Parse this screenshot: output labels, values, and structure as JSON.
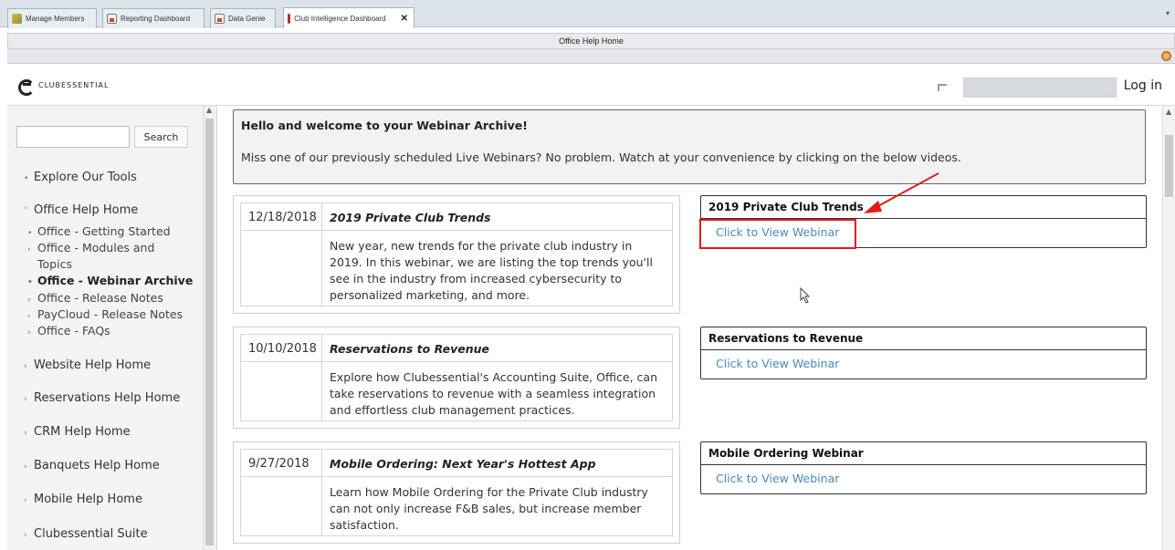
{
  "tabs": [
    {
      "label": "Manage Members",
      "icon": "members-icon"
    },
    {
      "label": "Reporting Dashboard",
      "icon": "report-icon"
    },
    {
      "label": "Data Genie",
      "icon": "report-icon"
    },
    {
      "label": "Club Intelligence Dashboard",
      "icon": "club-icon",
      "active": true
    }
  ],
  "window_title": "Office Help Home",
  "header": {
    "logo_text": "CLUBESSENTIAL",
    "search_placeholder": "",
    "login_label": "Log in"
  },
  "sidebar": {
    "search_button": "Search",
    "search_value": "",
    "items": [
      {
        "label": "Explore Our Tools"
      },
      {
        "label": "Office Help Home",
        "expanded": true
      },
      {
        "label": "Website Help Home"
      },
      {
        "label": "Reservations Help Home"
      },
      {
        "label": "CRM Help Home"
      },
      {
        "label": "Banquets Help Home"
      },
      {
        "label": "Mobile Help Home"
      },
      {
        "label": "Clubessential Suite"
      }
    ],
    "subitems": [
      {
        "label": "Office - Getting Started"
      },
      {
        "label": "Office - Modules and"
      },
      {
        "label": "Topics"
      },
      {
        "label": "Office - Webinar Archive",
        "active": true
      },
      {
        "label": "Office - Release Notes"
      },
      {
        "label": "PayCloud - Release Notes"
      },
      {
        "label": "Office - FAQs"
      }
    ]
  },
  "welcome": {
    "heading": "Hello and welcome to your Webinar Archive!",
    "text": "Miss one of our previously scheduled Live Webinars? No problem. Watch at your convenience by clicking on the below videos."
  },
  "webinars": [
    {
      "date": "12/18/2018",
      "title": "2019 Private Club Trends",
      "description": "New year, new trends for the private club industry in 2019. In this webinar, we are listing the top trends you'll see in the industry from increased cybersecurity to personalized marketing, and more.",
      "box_title": "2019 Private Club Trends",
      "link": "Click to View Webinar"
    },
    {
      "date": "10/10/2018",
      "title": "Reservations to Revenue",
      "description": "Explore how Clubessential's Accounting Suite, Office, can take reservations to revenue with a seamless integration and effortless club management practices.",
      "box_title": "Reservations to Revenue",
      "link": "Click to View Webinar"
    },
    {
      "date": "9/27/2018",
      "title": "Mobile Ordering: Next Year's Hottest App",
      "description": "Learn how Mobile Ordering for the Private Club industry can not only increase F&B sales, but increase member satisfaction.",
      "box_title": "Mobile Ordering Webinar",
      "link": "Click to View Webinar"
    }
  ],
  "colors": {
    "link": "#4a89b8",
    "annotation": "#e01b1b"
  }
}
